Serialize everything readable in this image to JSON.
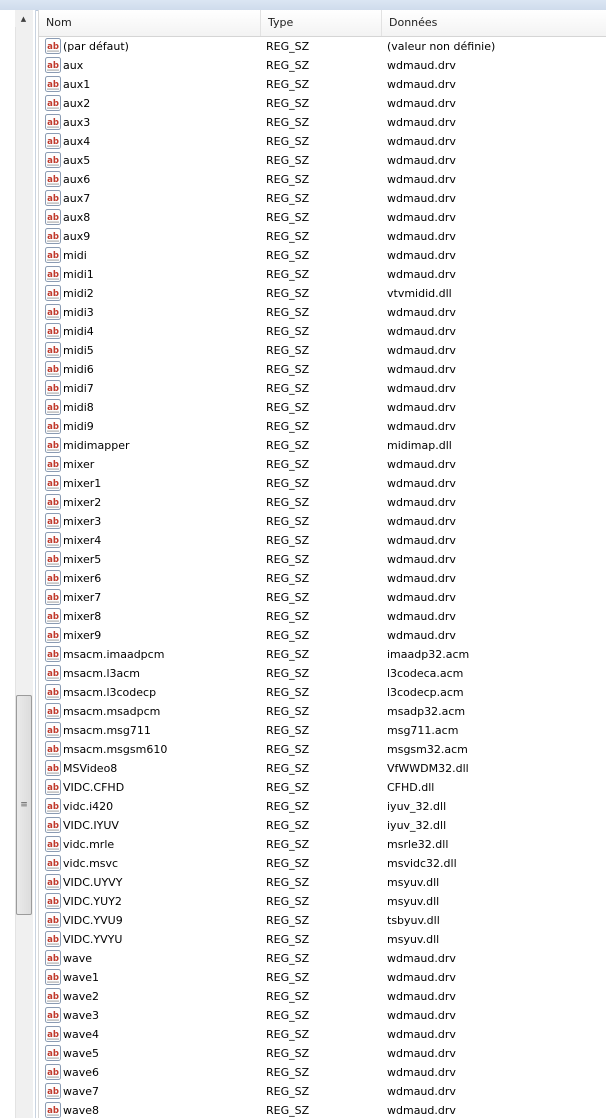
{
  "columns": {
    "name": "Nom",
    "type": "Type",
    "data": "Données"
  },
  "icon": "reg-sz-string-icon",
  "rows": [
    {
      "name": "(par défaut)",
      "type": "REG_SZ",
      "data": "(valeur non définie)"
    },
    {
      "name": "aux",
      "type": "REG_SZ",
      "data": "wdmaud.drv"
    },
    {
      "name": "aux1",
      "type": "REG_SZ",
      "data": "wdmaud.drv"
    },
    {
      "name": "aux2",
      "type": "REG_SZ",
      "data": "wdmaud.drv"
    },
    {
      "name": "aux3",
      "type": "REG_SZ",
      "data": "wdmaud.drv"
    },
    {
      "name": "aux4",
      "type": "REG_SZ",
      "data": "wdmaud.drv"
    },
    {
      "name": "aux5",
      "type": "REG_SZ",
      "data": "wdmaud.drv"
    },
    {
      "name": "aux6",
      "type": "REG_SZ",
      "data": "wdmaud.drv"
    },
    {
      "name": "aux7",
      "type": "REG_SZ",
      "data": "wdmaud.drv"
    },
    {
      "name": "aux8",
      "type": "REG_SZ",
      "data": "wdmaud.drv"
    },
    {
      "name": "aux9",
      "type": "REG_SZ",
      "data": "wdmaud.drv"
    },
    {
      "name": "midi",
      "type": "REG_SZ",
      "data": "wdmaud.drv"
    },
    {
      "name": "midi1",
      "type": "REG_SZ",
      "data": "wdmaud.drv"
    },
    {
      "name": "midi2",
      "type": "REG_SZ",
      "data": "vtvmidid.dll"
    },
    {
      "name": "midi3",
      "type": "REG_SZ",
      "data": "wdmaud.drv"
    },
    {
      "name": "midi4",
      "type": "REG_SZ",
      "data": "wdmaud.drv"
    },
    {
      "name": "midi5",
      "type": "REG_SZ",
      "data": "wdmaud.drv"
    },
    {
      "name": "midi6",
      "type": "REG_SZ",
      "data": "wdmaud.drv"
    },
    {
      "name": "midi7",
      "type": "REG_SZ",
      "data": "wdmaud.drv"
    },
    {
      "name": "midi8",
      "type": "REG_SZ",
      "data": "wdmaud.drv"
    },
    {
      "name": "midi9",
      "type": "REG_SZ",
      "data": "wdmaud.drv"
    },
    {
      "name": "midimapper",
      "type": "REG_SZ",
      "data": "midimap.dll"
    },
    {
      "name": "mixer",
      "type": "REG_SZ",
      "data": "wdmaud.drv"
    },
    {
      "name": "mixer1",
      "type": "REG_SZ",
      "data": "wdmaud.drv"
    },
    {
      "name": "mixer2",
      "type": "REG_SZ",
      "data": "wdmaud.drv"
    },
    {
      "name": "mixer3",
      "type": "REG_SZ",
      "data": "wdmaud.drv"
    },
    {
      "name": "mixer4",
      "type": "REG_SZ",
      "data": "wdmaud.drv"
    },
    {
      "name": "mixer5",
      "type": "REG_SZ",
      "data": "wdmaud.drv"
    },
    {
      "name": "mixer6",
      "type": "REG_SZ",
      "data": "wdmaud.drv"
    },
    {
      "name": "mixer7",
      "type": "REG_SZ",
      "data": "wdmaud.drv"
    },
    {
      "name": "mixer8",
      "type": "REG_SZ",
      "data": "wdmaud.drv"
    },
    {
      "name": "mixer9",
      "type": "REG_SZ",
      "data": "wdmaud.drv"
    },
    {
      "name": "msacm.imaadpcm",
      "type": "REG_SZ",
      "data": "imaadp32.acm"
    },
    {
      "name": "msacm.l3acm",
      "type": "REG_SZ",
      "data": "l3codeca.acm"
    },
    {
      "name": "msacm.l3codecp",
      "type": "REG_SZ",
      "data": "l3codecp.acm"
    },
    {
      "name": "msacm.msadpcm",
      "type": "REG_SZ",
      "data": "msadp32.acm"
    },
    {
      "name": "msacm.msg711",
      "type": "REG_SZ",
      "data": "msg711.acm"
    },
    {
      "name": "msacm.msgsm610",
      "type": "REG_SZ",
      "data": "msgsm32.acm"
    },
    {
      "name": "MSVideo8",
      "type": "REG_SZ",
      "data": "VfWWDM32.dll"
    },
    {
      "name": "VIDC.CFHD",
      "type": "REG_SZ",
      "data": "CFHD.dll"
    },
    {
      "name": "vidc.i420",
      "type": "REG_SZ",
      "data": "iyuv_32.dll"
    },
    {
      "name": "VIDC.IYUV",
      "type": "REG_SZ",
      "data": "iyuv_32.dll"
    },
    {
      "name": "vidc.mrle",
      "type": "REG_SZ",
      "data": "msrle32.dll"
    },
    {
      "name": "vidc.msvc",
      "type": "REG_SZ",
      "data": "msvidc32.dll"
    },
    {
      "name": "VIDC.UYVY",
      "type": "REG_SZ",
      "data": "msyuv.dll"
    },
    {
      "name": "VIDC.YUY2",
      "type": "REG_SZ",
      "data": "msyuv.dll"
    },
    {
      "name": "VIDC.YVU9",
      "type": "REG_SZ",
      "data": "tsbyuv.dll"
    },
    {
      "name": "VIDC.YVYU",
      "type": "REG_SZ",
      "data": "msyuv.dll"
    },
    {
      "name": "wave",
      "type": "REG_SZ",
      "data": "wdmaud.drv"
    },
    {
      "name": "wave1",
      "type": "REG_SZ",
      "data": "wdmaud.drv"
    },
    {
      "name": "wave2",
      "type": "REG_SZ",
      "data": "wdmaud.drv"
    },
    {
      "name": "wave3",
      "type": "REG_SZ",
      "data": "wdmaud.drv"
    },
    {
      "name": "wave4",
      "type": "REG_SZ",
      "data": "wdmaud.drv"
    },
    {
      "name": "wave5",
      "type": "REG_SZ",
      "data": "wdmaud.drv"
    },
    {
      "name": "wave6",
      "type": "REG_SZ",
      "data": "wdmaud.drv"
    },
    {
      "name": "wave7",
      "type": "REG_SZ",
      "data": "wdmaud.drv"
    },
    {
      "name": "wave8",
      "type": "REG_SZ",
      "data": "wdmaud.drv"
    }
  ]
}
